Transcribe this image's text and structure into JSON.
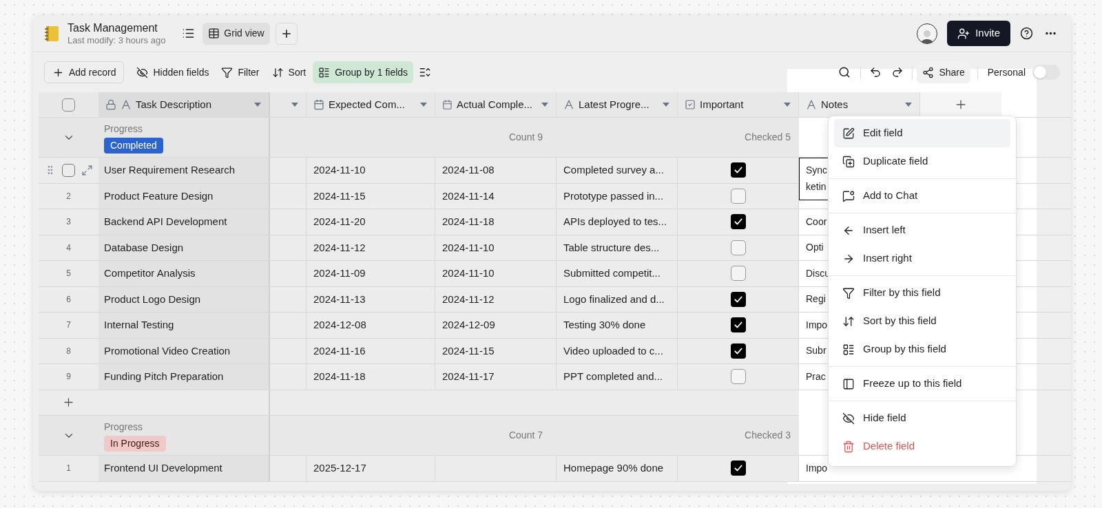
{
  "header": {
    "title": "Task Management",
    "subtitle": "Last modify: 3 hours ago",
    "views": [
      {
        "label": "Grid view",
        "selected": true
      }
    ],
    "invite": "Invite"
  },
  "toolbar": {
    "items": [
      {
        "kind": "add",
        "label": "Add record",
        "selected": false
      },
      {
        "kind": "hidden",
        "label": "Hidden fields",
        "selected": false
      },
      {
        "kind": "filter",
        "label": "Filter",
        "selected": false
      },
      {
        "kind": "sort",
        "label": "Sort",
        "selected": false
      },
      {
        "kind": "group",
        "label": "Group by 1 fields",
        "selected": true
      }
    ],
    "share": "Share",
    "mode": {
      "label": "Personal",
      "on": false
    }
  },
  "select_all_checked": false,
  "columns": [
    {
      "kind": "primary",
      "label": "Task Description"
    },
    {
      "kind": "hidden"
    },
    {
      "kind": "date",
      "label": "Expected Com..."
    },
    {
      "kind": "date",
      "label": "Actual Comple..."
    },
    {
      "kind": "text",
      "label": "Latest Progre..."
    },
    {
      "kind": "checkbox",
      "label": "Important"
    },
    {
      "kind": "text",
      "label": "Notes"
    }
  ],
  "groups": [
    {
      "field": "Progress",
      "tag": "Completed",
      "color": "#2b63cf",
      "count": "Count 9",
      "checked": "Checked 5",
      "expanded": true,
      "show_add_row": true,
      "rows": [
        {
          "hovered": true,
          "task": "User Requirement Research",
          "expected": "2024-11-10",
          "actual": "2024-11-08",
          "progress": "Completed survey a...",
          "important": true,
          "notes": [
            "Sync",
            "ketin"
          ],
          "editing": true
        },
        {
          "hovered": false,
          "number": "2",
          "task": "Product Feature Design",
          "expected": "2024-11-15",
          "actual": "2024-11-14",
          "progress": "Prototype passed in...",
          "important": false,
          "notes": [],
          "editing": false
        },
        {
          "hovered": false,
          "number": "3",
          "task": "Backend API Development",
          "expected": "2024-11-20",
          "actual": "2024-11-18",
          "progress": "APIs deployed to tes...",
          "important": true,
          "notes": [
            "Coor"
          ],
          "editing": false
        },
        {
          "hovered": false,
          "number": "4",
          "task": "Database Design",
          "expected": "2024-11-12",
          "actual": "2024-11-10",
          "progress": "Table structure des...",
          "important": false,
          "notes": [
            "Opti"
          ],
          "editing": false
        },
        {
          "hovered": false,
          "number": "5",
          "task": "Competitor Analysis",
          "expected": "2024-11-09",
          "actual": "2024-11-10",
          "progress": "Submitted competit...",
          "important": false,
          "notes": [
            "Discu"
          ],
          "editing": false
        },
        {
          "hovered": false,
          "number": "6",
          "task": "Product Logo Design",
          "expected": "2024-11-13",
          "actual": "2024-11-12",
          "progress": "Logo finalized and d...",
          "important": true,
          "notes": [
            "Regi"
          ],
          "editing": false
        },
        {
          "hovered": false,
          "number": "7",
          "task": "Internal Testing",
          "expected": "2024-12-08",
          "actual": "2024-12-09",
          "progress": "Testing 30% done",
          "important": true,
          "notes": [
            "Impo"
          ],
          "editing": false
        },
        {
          "hovered": false,
          "number": "8",
          "task": "Promotional Video Creation",
          "expected": "2024-11-16",
          "actual": "2024-11-15",
          "progress": "Video uploaded to c...",
          "important": true,
          "notes": [
            "Subr"
          ],
          "editing": false
        },
        {
          "hovered": false,
          "number": "9",
          "task": "Funding Pitch Preparation",
          "expected": "2024-11-18",
          "actual": "2024-11-17",
          "progress": "PPT completed and...",
          "important": false,
          "notes": [
            "Prac"
          ],
          "editing": false
        }
      ]
    },
    {
      "field": "Progress",
      "tag": "In Progress",
      "color": "#f2c9c9",
      "count": "Count 7",
      "checked": "Checked 3",
      "expanded": true,
      "show_add_row": false,
      "rows": [
        {
          "hovered": false,
          "number": "1",
          "task": "Frontend UI Development",
          "expected": "2025-12-17",
          "actual": "",
          "progress": "Homepage 90% done",
          "important": true,
          "notes": [
            "Impo"
          ],
          "editing": false
        }
      ]
    }
  ],
  "menu": {
    "sections": [
      [
        {
          "label": "Edit field",
          "selected": true,
          "kind": "normal"
        },
        {
          "label": "Duplicate field",
          "selected": false,
          "kind": "normal"
        }
      ],
      [
        {
          "label": "Add to Chat",
          "selected": false,
          "kind": "normal"
        }
      ],
      [
        {
          "label": "Insert left",
          "selected": false,
          "kind": "normal"
        },
        {
          "label": "Insert right",
          "selected": false,
          "kind": "normal"
        }
      ],
      [
        {
          "label": "Filter by this field",
          "selected": false,
          "kind": "normal"
        },
        {
          "label": "Sort by this field",
          "selected": false,
          "kind": "normal"
        },
        {
          "label": "Group by this field",
          "selected": false,
          "kind": "normal"
        }
      ],
      [
        {
          "label": "Freeze up to this field",
          "selected": false,
          "kind": "normal"
        }
      ],
      [
        {
          "label": "Hide field",
          "selected": false,
          "kind": "normal"
        },
        {
          "label": "Delete field",
          "selected": false,
          "kind": "danger"
        }
      ]
    ]
  }
}
